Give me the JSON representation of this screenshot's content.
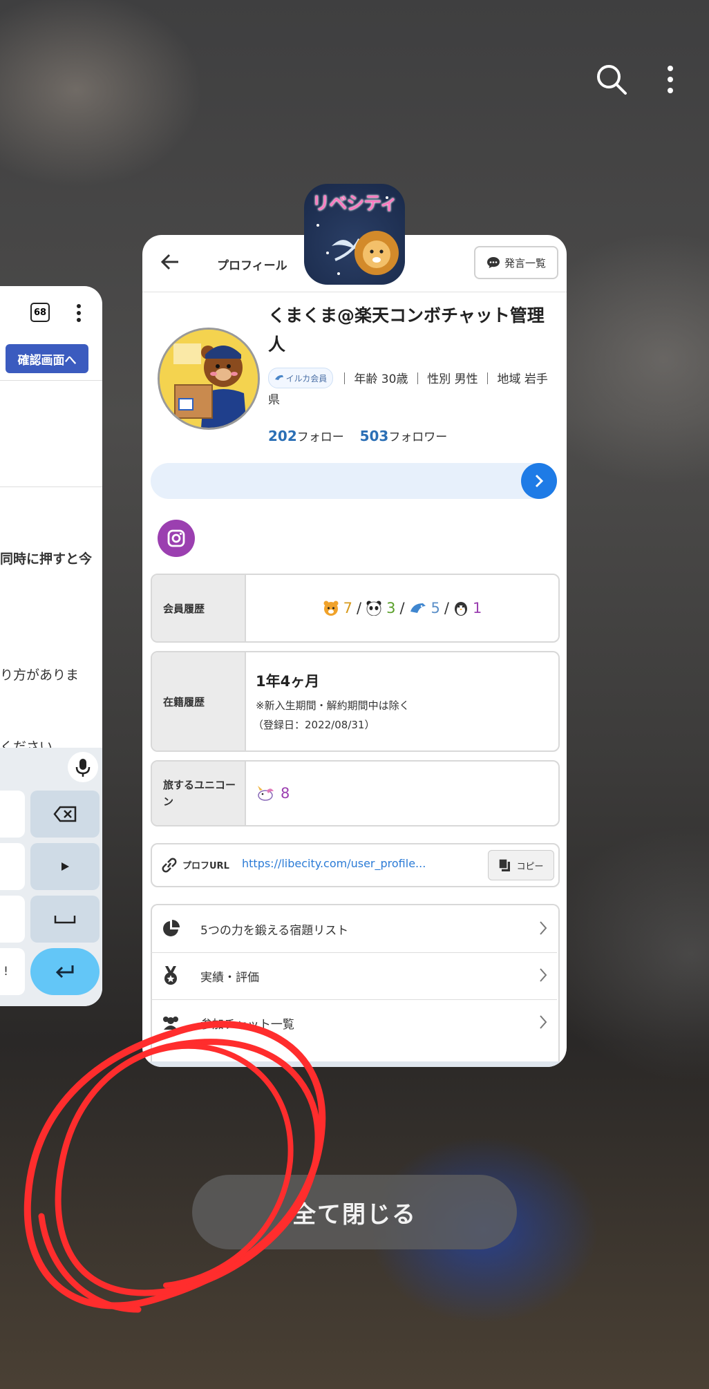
{
  "top_icons": {
    "search": "search-icon",
    "more": "more-vert-icon"
  },
  "left_card": {
    "tab_count": "68",
    "confirm_button": "確認画面へ",
    "snippets": [
      "同時に押すと今",
      "り方がありま",
      "ください。"
    ],
    "keyboard": {
      "exclaim_key": "!"
    }
  },
  "main_card": {
    "header": {
      "title": "プロフィール",
      "posts_button": "発言一覧"
    },
    "app_badge_text": "リベシティ",
    "profile": {
      "name": "くまくま@楽天コンボチャット管理人",
      "member_badge": "イルカ会員",
      "details": "｜ 年齢 30歳 ｜ 性別 男性 ｜ 地域 岩手県",
      "follow_count": "202",
      "follow_label": "フォロー",
      "follower_count": "503",
      "follower_label": "フォロワー"
    },
    "member_history": {
      "label": "会員履歴",
      "tiger": "7",
      "panda": "3",
      "dolphin": "5",
      "penguin": "1",
      "sep": "/"
    },
    "tenure": {
      "label": "在籍履歴",
      "duration": "1年4ヶ月",
      "note": "※新入生期間・解約期間中は除く",
      "registered": "（登録日：2022/08/31）"
    },
    "unicorn": {
      "label": "旅するユニコーン",
      "count": "8"
    },
    "profile_url": {
      "label": "プロフURL",
      "url": "https://libecity.com/user_profile...",
      "copy": "コピー"
    },
    "menu": [
      {
        "label": "5つの力を鍛える宿題リスト"
      },
      {
        "label": "実績・評価"
      },
      {
        "label": "参加チャット一覧"
      }
    ],
    "colors": {
      "accent": "#2b7bd6",
      "purple": "#9b3fb0",
      "gold": "#d79a1c",
      "green": "#5aa02a"
    }
  },
  "close_all_button": "全て閉じる"
}
